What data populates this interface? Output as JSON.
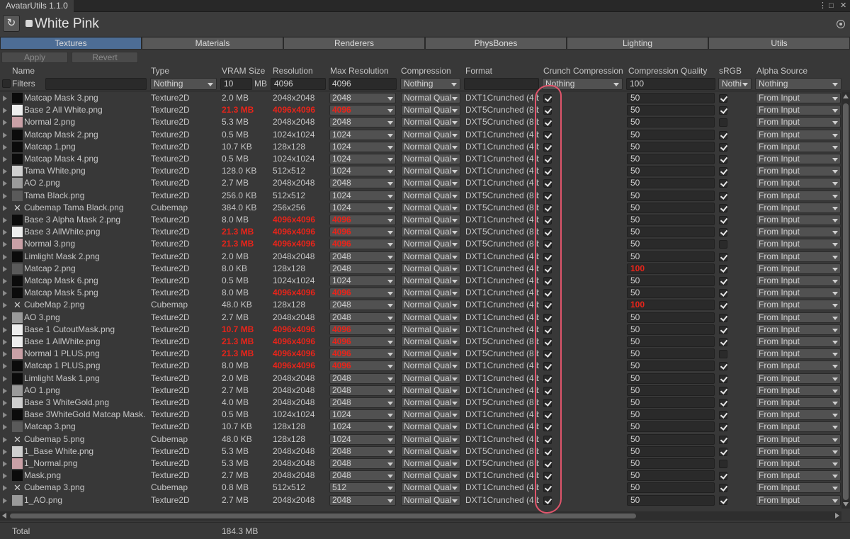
{
  "window": {
    "title": "AvatarUtils 1.1.0"
  },
  "header": {
    "object_name": "White Pink"
  },
  "tabs": [
    {
      "label": "Textures",
      "active": true
    },
    {
      "label": "Materials"
    },
    {
      "label": "Renderers"
    },
    {
      "label": "PhysBones"
    },
    {
      "label": "Lighting"
    },
    {
      "label": "Utils"
    }
  ],
  "actions": {
    "apply": "Apply",
    "revert": "Revert"
  },
  "columns": {
    "name": "Name",
    "type": "Type",
    "vram": "VRAM Size",
    "resolution": "Resolution",
    "max_resolution": "Max Resolution",
    "compression": "Compression",
    "format": "Format",
    "crunch": "Crunch Compression",
    "quality": "Compression Quality",
    "srgb": "sRGB",
    "alpha": "Alpha Source"
  },
  "filters": {
    "label": "Filters",
    "name": "",
    "type": "Nothing",
    "vram": "10",
    "vram_unit": "MB",
    "resolution": "4096",
    "max_resolution": "4096",
    "compression": "Nothing",
    "format": "",
    "crunch": "Nothing",
    "quality": "100",
    "srgb": "Nothi",
    "alpha": "Nothing"
  },
  "rows": [
    {
      "name": "Matcap Mask 3.png",
      "thumb": "mask",
      "type": "Texture2D",
      "vram": "2.0 MB",
      "res": "2048x2048",
      "max": "2048",
      "comp": "Normal Qual",
      "format": "DXT1Crunched (4 b",
      "crunch": true,
      "quality": "50",
      "srgb": true,
      "alpha": "From Input"
    },
    {
      "name": "Base 2 All White.png",
      "thumb": "white",
      "type": "Texture2D",
      "vram": "21.3 MB",
      "res": "4096x4096",
      "max": "4096",
      "comp": "Normal Qual",
      "format": "DXT5Crunched (8 b",
      "crunch": true,
      "quality": "50",
      "srgb": true,
      "alpha": "From Input",
      "warn": true
    },
    {
      "name": "Normal 2.png",
      "thumb": "pink",
      "type": "Texture2D",
      "vram": "5.3 MB",
      "res": "2048x2048",
      "max": "2048",
      "comp": "Normal Qual",
      "format": "DXT5Crunched (8 b",
      "crunch": true,
      "quality": "50",
      "srgb": false,
      "alpha": "From Input"
    },
    {
      "name": "Matcap Mask 2.png",
      "thumb": "mask",
      "type": "Texture2D",
      "vram": "0.5 MB",
      "res": "1024x1024",
      "max": "1024",
      "comp": "Normal Qual",
      "format": "DXT1Crunched (4 b",
      "crunch": true,
      "quality": "50",
      "srgb": true,
      "alpha": "From Input"
    },
    {
      "name": "Matcap 1.png",
      "thumb": "mask",
      "type": "Texture2D",
      "vram": "10.7 KB",
      "res": "128x128",
      "max": "1024",
      "comp": "Normal Qual",
      "format": "DXT1Crunched (4 b",
      "crunch": true,
      "quality": "50",
      "srgb": true,
      "alpha": "From Input"
    },
    {
      "name": "Matcap Mask 4.png",
      "thumb": "mask",
      "type": "Texture2D",
      "vram": "0.5 MB",
      "res": "1024x1024",
      "max": "1024",
      "comp": "Normal Qual",
      "format": "DXT1Crunched (4 b",
      "crunch": true,
      "quality": "50",
      "srgb": true,
      "alpha": "From Input"
    },
    {
      "name": "Tama White.png",
      "thumb": "light",
      "type": "Texture2D",
      "vram": "128.0 KB",
      "res": "512x512",
      "max": "1024",
      "comp": "Normal Qual",
      "format": "DXT1Crunched (4 b",
      "crunch": true,
      "quality": "50",
      "srgb": true,
      "alpha": "From Input"
    },
    {
      "name": "AO 2.png",
      "thumb": "ao",
      "type": "Texture2D",
      "vram": "2.7 MB",
      "res": "2048x2048",
      "max": "2048",
      "comp": "Normal Qual",
      "format": "DXT1Crunched (4 b",
      "crunch": true,
      "quality": "50",
      "srgb": true,
      "alpha": "From Input"
    },
    {
      "name": "Tama Black.png",
      "thumb": "gray",
      "type": "Texture2D",
      "vram": "256.0 KB",
      "res": "512x512",
      "max": "1024",
      "comp": "Normal Qual",
      "format": "DXT5Crunched (8 b",
      "crunch": true,
      "quality": "50",
      "srgb": true,
      "alpha": "From Input"
    },
    {
      "name": "Cubemap Tama Black.png",
      "thumb": "cube",
      "type": "Cubemap",
      "vram": "384.0 KB",
      "res": "256x256",
      "max": "1024",
      "comp": "Normal Qual",
      "format": "DXT5Crunched (8 b",
      "crunch": true,
      "quality": "50",
      "srgb": true,
      "alpha": "From Input"
    },
    {
      "name": "Base 3 Alpha Mask 2.png",
      "thumb": "mask",
      "type": "Texture2D",
      "vram": "8.0 MB",
      "res": "4096x4096",
      "max": "4096",
      "comp": "Normal Qual",
      "format": "DXT1Crunched (4 b",
      "crunch": true,
      "quality": "50",
      "srgb": true,
      "alpha": "From Input",
      "warn_res": true
    },
    {
      "name": "Base 3 AllWhite.png",
      "thumb": "white",
      "type": "Texture2D",
      "vram": "21.3 MB",
      "res": "4096x4096",
      "max": "4096",
      "comp": "Normal Qual",
      "format": "DXT5Crunched (8 b",
      "crunch": true,
      "quality": "50",
      "srgb": true,
      "alpha": "From Input",
      "warn": true
    },
    {
      "name": "Normal 3.png",
      "thumb": "pink",
      "type": "Texture2D",
      "vram": "21.3 MB",
      "res": "4096x4096",
      "max": "4096",
      "comp": "Normal Qual",
      "format": "DXT5Crunched (8 b",
      "crunch": true,
      "quality": "50",
      "srgb": false,
      "alpha": "From Input",
      "warn": true
    },
    {
      "name": "Limlight Mask 2.png",
      "thumb": "mask",
      "type": "Texture2D",
      "vram": "2.0 MB",
      "res": "2048x2048",
      "max": "2048",
      "comp": "Normal Qual",
      "format": "DXT1Crunched (4 b",
      "crunch": true,
      "quality": "50",
      "srgb": true,
      "alpha": "From Input"
    },
    {
      "name": "Matcap 2.png",
      "thumb": "gray",
      "type": "Texture2D",
      "vram": "8.0 KB",
      "res": "128x128",
      "max": "2048",
      "comp": "Normal Qual",
      "format": "DXT1Crunched (4 b",
      "crunch": true,
      "quality": "100",
      "srgb": true,
      "alpha": "From Input",
      "warn_q": true
    },
    {
      "name": "Matcap Mask 6.png",
      "thumb": "mask",
      "type": "Texture2D",
      "vram": "0.5 MB",
      "res": "1024x1024",
      "max": "1024",
      "comp": "Normal Qual",
      "format": "DXT1Crunched (4 b",
      "crunch": true,
      "quality": "50",
      "srgb": true,
      "alpha": "From Input"
    },
    {
      "name": "Matcap Mask 5.png",
      "thumb": "mask",
      "type": "Texture2D",
      "vram": "8.0 MB",
      "res": "4096x4096",
      "max": "4096",
      "comp": "Normal Qual",
      "format": "DXT1Crunched (4 b",
      "crunch": true,
      "quality": "50",
      "srgb": true,
      "alpha": "From Input",
      "warn_res": true
    },
    {
      "name": "CubeMap 2.png",
      "thumb": "cube",
      "type": "Cubemap",
      "vram": "48.0 KB",
      "res": "128x128",
      "max": "2048",
      "comp": "Normal Qual",
      "format": "DXT1Crunched (4 b",
      "crunch": true,
      "quality": "100",
      "srgb": true,
      "alpha": "From Input",
      "warn_q": true
    },
    {
      "name": "AO 3.png",
      "thumb": "ao",
      "type": "Texture2D",
      "vram": "2.7 MB",
      "res": "2048x2048",
      "max": "2048",
      "comp": "Normal Qual",
      "format": "DXT1Crunched (4 b",
      "crunch": true,
      "quality": "50",
      "srgb": true,
      "alpha": "From Input"
    },
    {
      "name": "Base 1 CutoutMask.png",
      "thumb": "white",
      "type": "Texture2D",
      "vram": "10.7 MB",
      "res": "4096x4096",
      "max": "4096",
      "comp": "Normal Qual",
      "format": "DXT1Crunched (4 b",
      "crunch": true,
      "quality": "50",
      "srgb": true,
      "alpha": "From Input",
      "warn": true
    },
    {
      "name": "Base 1 AllWhite.png",
      "thumb": "white",
      "type": "Texture2D",
      "vram": "21.3 MB",
      "res": "4096x4096",
      "max": "4096",
      "comp": "Normal Qual",
      "format": "DXT5Crunched (8 b",
      "crunch": true,
      "quality": "50",
      "srgb": true,
      "alpha": "From Input",
      "warn": true
    },
    {
      "name": "Normal 1 PLUS.png",
      "thumb": "pink",
      "type": "Texture2D",
      "vram": "21.3 MB",
      "res": "4096x4096",
      "max": "4096",
      "comp": "Normal Qual",
      "format": "DXT5Crunched (8 b",
      "crunch": true,
      "quality": "50",
      "srgb": false,
      "alpha": "From Input",
      "warn": true
    },
    {
      "name": "Matcap 1 PLUS.png",
      "thumb": "mask",
      "type": "Texture2D",
      "vram": "8.0 MB",
      "res": "4096x4096",
      "max": "4096",
      "comp": "Normal Qual",
      "format": "DXT1Crunched (4 b",
      "crunch": true,
      "quality": "50",
      "srgb": true,
      "alpha": "From Input",
      "warn_res": true
    },
    {
      "name": "Limlight Mask 1.png",
      "thumb": "mask",
      "type": "Texture2D",
      "vram": "2.0 MB",
      "res": "2048x2048",
      "max": "2048",
      "comp": "Normal Qual",
      "format": "DXT1Crunched (4 b",
      "crunch": true,
      "quality": "50",
      "srgb": true,
      "alpha": "From Input"
    },
    {
      "name": "AO 1.png",
      "thumb": "ao",
      "type": "Texture2D",
      "vram": "2.7 MB",
      "res": "2048x2048",
      "max": "2048",
      "comp": "Normal Qual",
      "format": "DXT1Crunched (4 b",
      "crunch": true,
      "quality": "50",
      "srgb": true,
      "alpha": "From Input"
    },
    {
      "name": "Base 3 WhiteGold.png",
      "thumb": "light",
      "type": "Texture2D",
      "vram": "4.0 MB",
      "res": "2048x2048",
      "max": "2048",
      "comp": "Normal Qual",
      "format": "DXT5Crunched (8 b",
      "crunch": true,
      "quality": "50",
      "srgb": true,
      "alpha": "From Input"
    },
    {
      "name": "Base 3WhiteGold Matcap Mask.",
      "thumb": "mask",
      "type": "Texture2D",
      "vram": "0.5 MB",
      "res": "1024x1024",
      "max": "1024",
      "comp": "Normal Qual",
      "format": "DXT1Crunched (4 b",
      "crunch": true,
      "quality": "50",
      "srgb": true,
      "alpha": "From Input"
    },
    {
      "name": "Matcap 3.png",
      "thumb": "gray",
      "type": "Texture2D",
      "vram": "10.7 KB",
      "res": "128x128",
      "max": "1024",
      "comp": "Normal Qual",
      "format": "DXT1Crunched (4 b",
      "crunch": true,
      "quality": "50",
      "srgb": true,
      "alpha": "From Input"
    },
    {
      "name": "Cubemap 5.png",
      "thumb": "cube",
      "type": "Cubemap",
      "vram": "48.0 KB",
      "res": "128x128",
      "max": "1024",
      "comp": "Normal Qual",
      "format": "DXT1Crunched (4 b",
      "crunch": true,
      "quality": "50",
      "srgb": true,
      "alpha": "From Input"
    },
    {
      "name": "1_Base White.png",
      "thumb": "light",
      "type": "Texture2D",
      "vram": "5.3 MB",
      "res": "2048x2048",
      "max": "2048",
      "comp": "Normal Qual",
      "format": "DXT5Crunched (8 b",
      "crunch": true,
      "quality": "50",
      "srgb": true,
      "alpha": "From Input"
    },
    {
      "name": "1_Normal.png",
      "thumb": "pink",
      "type": "Texture2D",
      "vram": "5.3 MB",
      "res": "2048x2048",
      "max": "2048",
      "comp": "Normal Qual",
      "format": "DXT5Crunched (8 b",
      "crunch": true,
      "quality": "50",
      "srgb": false,
      "alpha": "From Input"
    },
    {
      "name": "Mask.png",
      "thumb": "mask",
      "type": "Texture2D",
      "vram": "2.7 MB",
      "res": "2048x2048",
      "max": "2048",
      "comp": "Normal Qual",
      "format": "DXT1Crunched (4 b",
      "crunch": true,
      "quality": "50",
      "srgb": true,
      "alpha": "From Input"
    },
    {
      "name": "Cubemap 3.png",
      "thumb": "cube",
      "type": "Cubemap",
      "vram": "0.8 MB",
      "res": "512x512",
      "max": "512",
      "comp": "Normal Qual",
      "format": "DXT1Crunched (4 b",
      "crunch": true,
      "quality": "50",
      "srgb": true,
      "alpha": "From Input"
    },
    {
      "name": "1_AO.png",
      "thumb": "ao",
      "type": "Texture2D",
      "vram": "2.7 MB",
      "res": "2048x2048",
      "max": "2048",
      "comp": "Normal Qual",
      "format": "DXT1Crunched (4 b",
      "crunch": true,
      "quality": "50",
      "srgb": true,
      "alpha": "From Input"
    }
  ],
  "footer": {
    "label": "Total",
    "value": "184.3 MB"
  },
  "colors": {
    "warning": "#e8241a",
    "tab_active": "#4d6d95",
    "annotation": "#e0546b"
  },
  "icons": {
    "refresh": "refresh-icon",
    "cubemap": "cubemap-icon",
    "menu": "kebab-menu-icon"
  }
}
